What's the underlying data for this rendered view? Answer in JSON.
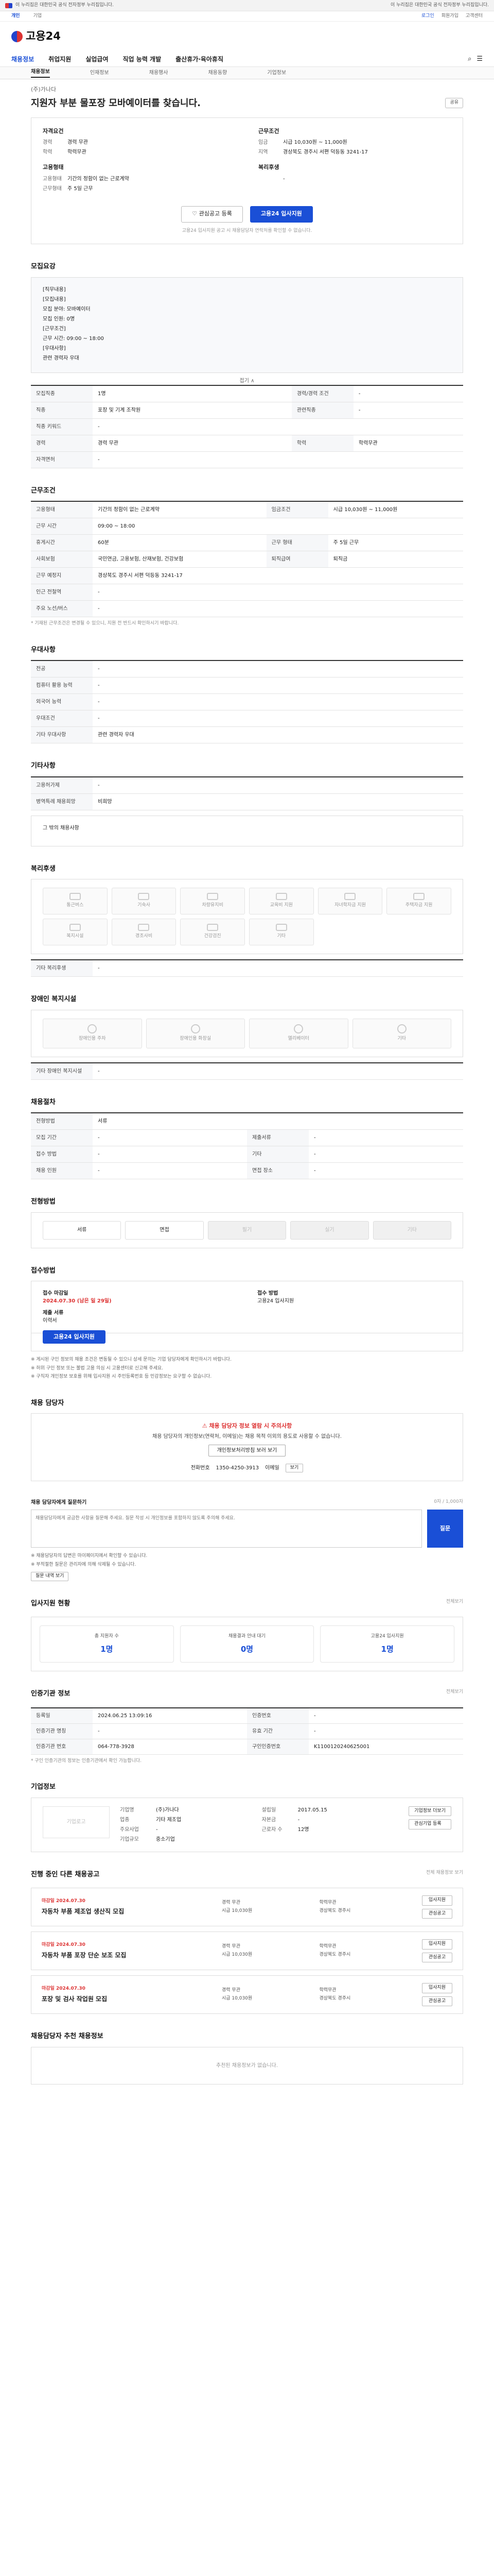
{
  "gov_banner": {
    "text": "이 누리집은 대한민국 공식 전자정부 누리집입니다.",
    "right": "이 누리집은 대한민국 공식 전자정부 누리집입니다."
  },
  "util": {
    "tabs": [
      "개인",
      "기업"
    ],
    "links": [
      "로그인",
      "회원가입",
      "고객센터"
    ]
  },
  "logo": {
    "text": "고용24"
  },
  "gnb": {
    "items": [
      "채용정보",
      "취업지원",
      "실업급여",
      "직업 능력 개발",
      "출산휴가·육아휴직"
    ],
    "icons": [
      "search-icon",
      "menu-icon"
    ]
  },
  "lnb": {
    "items": [
      "채용정보",
      "인재정보",
      "채용행사",
      "채용동향",
      "기업정보"
    ]
  },
  "job": {
    "company": "(주)가나다",
    "title": "지원자 부분 물포장 모바예이터를 찾습니다.",
    "share_label": "공유"
  },
  "summary": {
    "groups": [
      {
        "title": "자격요건",
        "rows": [
          {
            "k": "경력",
            "v": "경력 무관"
          },
          {
            "k": "학력",
            "v": "학력무관"
          }
        ]
      },
      {
        "title": "근무조건",
        "rows": [
          {
            "k": "임금",
            "v": "시급 10,030원 ~ 11,000원"
          },
          {
            "k": "지역",
            "v": "경상북도 경주시 서편 덕등동 3241-17"
          }
        ]
      },
      {
        "title": "고용형태",
        "rows": [
          {
            "k": "고용형태",
            "v": "기간의 정함이 없는 근로계약"
          },
          {
            "k": "근무형태",
            "v": "주 5일 근무"
          }
        ]
      },
      {
        "title": "복리후생",
        "rows": [
          {
            "k": "",
            "v": "-"
          }
        ]
      }
    ],
    "btn_save": "관심공고 등록",
    "btn_apply": "고용24 입사지원",
    "notice": "고용24 입사지원 공고 시 채용담당자 연락처를 확인할 수 없습니다."
  },
  "sec_recruit": {
    "title": "모집요강",
    "lines": [
      "[직무내용]",
      "[모집내용]",
      "모집 분야: 모바예이터",
      "모집 인원: 0명",
      "[근무조건]",
      "근무 시간: 09:00 ~ 18:00",
      "[우대사항]",
      "관련 경력자 우대"
    ],
    "fold": "접기 ∧",
    "rows": [
      {
        "th": "모집직종",
        "td": "1명",
        "th2": "경력/경력 조건",
        "td2": "-"
      },
      {
        "th": "직종",
        "td": "포장 및 기계 조작원",
        "th2": "관련직종",
        "td2": "-"
      },
      {
        "th": "직종 키워드",
        "td": "-",
        "th2": "",
        "td2": ""
      },
      {
        "th": "경력",
        "td": "경력 무관",
        "th2": "학력",
        "td2": "학력무관"
      },
      {
        "th": "자격면허",
        "td": "-",
        "th2": "",
        "td2": ""
      }
    ]
  },
  "sec_work": {
    "title": "근무조건",
    "rows": [
      {
        "th": "고용형태",
        "td": "기간의 정함이 없는 근로계약",
        "th2": "임금조건",
        "td2": "시급 10,030원 ~ 11,000원"
      },
      {
        "th": "근무 시간",
        "td": "09:00 ~ 18:00",
        "th2": "",
        "td2": ""
      },
      {
        "th": "휴게시간",
        "td": "60분",
        "th2": "근무 형태",
        "td2": "주 5일 근무"
      },
      {
        "th": "사회보험",
        "td": "국민연금, 고용보험, 산재보험, 건강보험",
        "th2": "퇴직급여",
        "td2": "퇴직금"
      },
      {
        "th": "근무 예정지",
        "td": "경상북도 경주시 서편 덕등동 3241-17",
        "th2": "",
        "td2": ""
      },
      {
        "th": "인근 전철역",
        "td": "-",
        "th2": "",
        "td2": ""
      },
      {
        "th": "주요 노선/버스",
        "td": "-",
        "th2": "",
        "td2": ""
      }
    ],
    "map_btn": "지도 보기",
    "foot": "* 기재된 근무조건은 변경될 수 있으니, 지원 전 반드시 확인하시기 바랍니다."
  },
  "sec_prefer": {
    "title": "우대사항",
    "rows": [
      {
        "th": "전공",
        "td": "-"
      },
      {
        "th": "컴퓨터 활용 능력",
        "td": "-"
      },
      {
        "th": "외국어 능력",
        "td": "-"
      },
      {
        "th": "우대조건",
        "td": "-"
      },
      {
        "th": "기타 우대사항",
        "td": "관련 경력자 우대"
      }
    ]
  },
  "sec_etc": {
    "title": "기타사항",
    "rows": [
      {
        "th": "고용허가제",
        "td": "-"
      },
      {
        "th": "병역특례 채용희망",
        "td": "비희망"
      }
    ],
    "extra": "그 밖의 채용사항"
  },
  "sec_welfare": {
    "title": "복리후생",
    "items": [
      "통근버스",
      "기숙사",
      "차량유지비",
      "교육비 지원",
      "자녀학자금 지원",
      "주택자금 지원",
      "복지시설",
      "경조사비",
      "건강검진",
      "기타"
    ],
    "extra_label": "기타 복리후생",
    "extra_value": "-"
  },
  "sec_disabled": {
    "title": "장애인 복지시설",
    "items": [
      "장애인용 주차",
      "장애인용 화장실",
      "엘리베이터",
      "기타"
    ],
    "extra_label": "기타 장애인 복지시설",
    "extra_value": "-"
  },
  "sec_apply_method": {
    "title": "채용절차",
    "rows": [
      {
        "th": "전형방법",
        "td": "서류",
        "th2": "",
        "td2": ""
      },
      {
        "th": "모집 기간",
        "td": "-",
        "th2": "제출서류",
        "td2": "-"
      },
      {
        "th": "접수 방법",
        "td": "-",
        "th2": "기타",
        "td2": "-"
      },
      {
        "th": "채용 인원",
        "td": "-",
        "th2": "면접 장소",
        "td2": "-"
      }
    ]
  },
  "sec_process": {
    "title": "전형방법",
    "tabs": [
      "서류",
      "면접",
      "필기",
      "실기",
      "기타"
    ]
  },
  "sec_receipt": {
    "title": "접수방법",
    "items": [
      {
        "lbl": "접수 마감일",
        "val": "2024.07.30 (남은 일 29일)",
        "red": true
      },
      {
        "lbl": "접수 방법",
        "val": "고용24 입사지원",
        "red": false
      },
      {
        "lbl": "제출 서류",
        "val": "이력서",
        "red": false
      },
      {
        "lbl": "",
        "val": "",
        "red": false
      }
    ],
    "apply_btn": "고용24 입사지원",
    "notes": [
      "※ 게시된 구인 정보의 채용 조건은 변동될 수 있으니 상세 문의는 기업 담당자에게 확인하시기 바랍니다.",
      "※ 허위 구인 정보 또는 불법 고용 의심 시 고용센터로 신고해 주세요.",
      "※ 구직자 개인정보 보호를 위해 입사지원 시 주민등록번호 등 민감정보는 요구할 수 없습니다."
    ]
  },
  "sec_contact": {
    "title": "채용 담당자",
    "warn": "채용 담당자 정보 열람 시 주의사항",
    "text": "채용 담당자의 개인정보(연락처, 이메일)는 채용 목적 이외의 용도로 사용할 수 없습니다.",
    "confirm_btn": "개인정보처리방침 보러 보기",
    "contact_label": "전화번호",
    "contact_value": "1350-4250-3913",
    "contact_label2": "이메일",
    "contact_btn": "보기"
  },
  "sec_qa": {
    "title": "채용 담당자에게 질문하기",
    "right": "0자 / 1,000자",
    "placeholder": "채용담당자에게 궁금한 사항을 질문해 주세요. 질문 작성 시 개인정보를 포함하지 않도록 주의해 주세요.",
    "send": "질문",
    "notes": [
      "※ 채용담당자의 답변은 마이페이지에서 확인할 수 있습니다.",
      "※ 부적절한 질문은 관리자에 의해 삭제될 수 있습니다."
    ],
    "link_btn": "질문 내역 보기"
  },
  "sec_stats": {
    "title": "입사지원 현황",
    "more": "전체보기",
    "items": [
      {
        "label": "총 지원자 수",
        "value": "1명"
      },
      {
        "label": "채용결과 안내 대기",
        "value": "0명"
      },
      {
        "label": "고용24 입사지원",
        "value": "1명"
      }
    ]
  },
  "sec_info": {
    "title": "인증기관 정보",
    "more": "전체보기",
    "rows": [
      {
        "th": "등록일",
        "td": "2024.06.25 13:09:16",
        "th2": "인증번호",
        "td2": "-"
      },
      {
        "th": "인증기관 명칭",
        "td": "-",
        "th2": "유효 기간",
        "td2": "-"
      },
      {
        "th": "인증기관 번호",
        "td": "064-778-3928",
        "th2": "구인인증번호",
        "td2": "K1100120240625001"
      }
    ],
    "foot": "* 구인 인증기관의 정보는 인증기관에서 확인 가능합니다."
  },
  "sec_company": {
    "title": "기업정보",
    "logo": "기업로고",
    "rows": [
      {
        "k": "기업명",
        "v": "(주)가나다",
        "k2": "설립일",
        "v2": "2017.05.15"
      },
      {
        "k": "업종",
        "v": "기타 제조업",
        "k2": "자본금",
        "v2": "-"
      },
      {
        "k": "주요사업",
        "v": "-",
        "k2": "근로자 수",
        "v2": "12명"
      },
      {
        "k": "기업규모",
        "v": "중소기업",
        "k2": "",
        "v2": ""
      }
    ],
    "btns": [
      "기업정보 더보기",
      "관심기업 등록"
    ]
  },
  "sec_jobs": {
    "title": "진행 중인 다른 채용공고",
    "more": "전체 채용정보 보기",
    "items": [
      {
        "date": "마감일 2024.07.30",
        "title": "자동차 부품 제조업 생산직 모집",
        "meta": [
          "경력 무관",
          "학력무관",
          "시급 10,030원",
          "경상북도 경주시"
        ],
        "btns": [
          "입사지원",
          "관심공고"
        ]
      },
      {
        "date": "마감일 2024.07.30",
        "title": "자동차 부품 포장 단순 보조 모집",
        "meta": [
          "경력 무관",
          "학력무관",
          "시급 10,030원",
          "경상북도 경주시"
        ],
        "btns": [
          "입사지원",
          "관심공고"
        ]
      },
      {
        "date": "마감일 2024.07.30",
        "title": "포장 및 검사 작업원 모집",
        "meta": [
          "경력 무관",
          "학력무관",
          "시급 10,030원",
          "경상북도 경주시"
        ],
        "btns": [
          "입사지원",
          "관심공고"
        ]
      }
    ]
  },
  "sec_recommend": {
    "title": "채용담당자 추천 채용정보",
    "empty": "추천된 채용정보가 없습니다."
  }
}
